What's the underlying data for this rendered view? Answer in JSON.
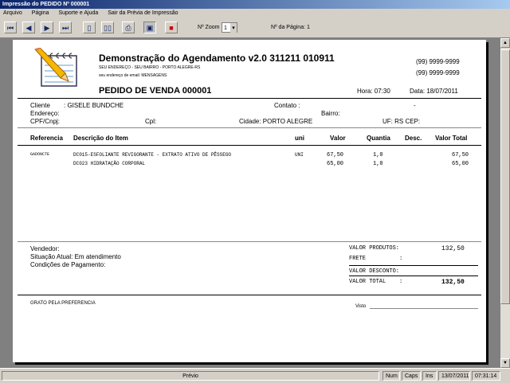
{
  "window": {
    "title": "Impressão do PEDIDO Nº 000001"
  },
  "menu": [
    "Arquivo",
    "Página",
    "Suporte e Ajuda",
    "Sair da Prévia de Impressão"
  ],
  "toolbar": {
    "zoom_label": "Nº Zoom",
    "zoom_value": "1",
    "page_label": "Nº da Página: 1"
  },
  "doc": {
    "company": "Demonstração do Agendamento v2.0 311211 010911",
    "address": "SEU ENDEREÇO - SEU BAIRRO - PORTO ALEGRE-RS",
    "email": "seu endereço de email: MENSAGENS",
    "phone1": "(99) 9999-9999",
    "phone2": "(99) 9999-9999",
    "order_title": "PEDIDO DE VENDA 000001",
    "hora": "Hora: 07:30",
    "data": "Data: 18/07/2011",
    "cliente_label": "Cliente",
    "cliente": ": GISELE BUNDCHE",
    "contato": "Contato :",
    "dash": "-",
    "endereco": "Endereço:",
    "bairro": "Bairro:",
    "cpf": "CPF/Cnpj:",
    "cpl": "Cpl:",
    "cidade": "Cidade: PORTO ALEGRE",
    "uf": "UF: RS  CEP:",
    "table": {
      "headers": [
        "Referencia",
        "Descrição do Item",
        "uni",
        "Valor",
        "Quantia",
        "Desc.",
        "Valor Total"
      ],
      "rows": [
        {
          "ref": "GADONCTE",
          "desc": "DC015-ESFOLIANTE REVIGORANTE - EXTRATO ATIVO DE PÊSSEGO",
          "uni": "UNI",
          "valor": "67,50",
          "qtd": "1,0",
          "desc_v": "",
          "total": "67,50"
        },
        {
          "ref": "",
          "desc": "DC023 HIDRATAÇÃO CORPORAL",
          "uni": "",
          "valor": "65,00",
          "qtd": "1,0",
          "desc_v": "",
          "total": "65,00"
        }
      ]
    },
    "vendedor": "Vendedor:",
    "situacao": "Situação Atual: Em atendimento",
    "condicoes": "Condições de Pagamento:",
    "totals": [
      {
        "label": "VALOR PRODUTOS:",
        "value": "132,50"
      },
      {
        "label": "FRETE          :",
        "value": ""
      },
      {
        "label": "VALOR DESCONTO:",
        "value": ""
      },
      {
        "label": "VALOR TOTAL    :",
        "value": "132,50"
      }
    ],
    "footer_left": "GRATO PELA PREFERENCIA",
    "visto": "Visto"
  },
  "status": {
    "mode": "Prévio",
    "num": "Num",
    "caps": "Caps",
    "ins": "Ins",
    "date": "13/07/2011",
    "time": "07:31:14"
  }
}
